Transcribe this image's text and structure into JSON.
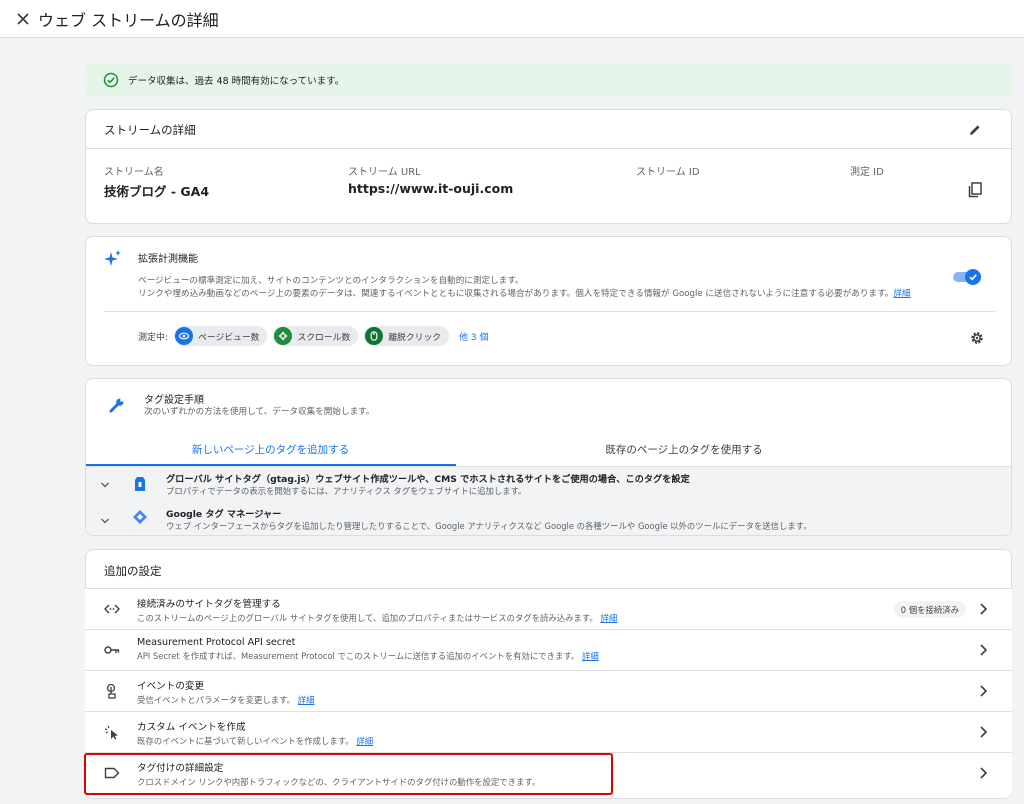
{
  "header": {
    "title": "ウェブ ストリームの詳細"
  },
  "alert": {
    "text": "データ収集は、過去 48 時間有効になっています。"
  },
  "stream_details": {
    "title": "ストリームの詳細",
    "name_label": "ストリーム名",
    "name_value": "技術ブログ - GA4",
    "url_label": "ストリーム URL",
    "url_value": "https://www.it-ouji.com",
    "id_label": "ストリーム ID",
    "measurement_id_label": "測定 ID"
  },
  "enhanced": {
    "title": "拡張計測機能",
    "desc1": "ページビューの標準測定に加え、サイトのコンテンツとのインタラクションを自動的に測定します。",
    "desc2": "リンクや埋め込み動画などのページ上の要素のデータは、関連するイベントとともに収集される場合があります。個人を特定できる情報が Google に送信されないように注意する必要があります。",
    "desc2_link": "詳細",
    "measuring_label": "測定中:",
    "chips": [
      "ページビュー数",
      "スクロール数",
      "離脱クリック"
    ],
    "more_link": "他 3 個",
    "toggle_on": true
  },
  "tagging": {
    "title": "タグ設定手順",
    "subtitle": "次のいずれかの方法を使用して、データ収集を開始します。",
    "tabs": [
      "新しいページ上のタグを追加する",
      "既存のページ上のタグを使用する"
    ],
    "options": [
      {
        "title": "グローバル サイトタグ（gtag.js）ウェブサイト作成ツールや、CMS でホストされるサイトをご使用の場合、このタグを設定",
        "desc": "プロパティでデータの表示を開始するには、アナリティクス タグをウェブサイトに追加します。"
      },
      {
        "title": "Google タグ マネージャー",
        "desc": "ウェブ インターフェースからタグを追加したり管理したりすることで、Google アナリティクスなど Google の各種ツールや Google 以外のツールにデータを送信します。"
      }
    ]
  },
  "additional": {
    "title": "追加の設定",
    "rows": [
      {
        "title": "接続済みのサイトタグを管理する",
        "desc": "このストリームのページ上のグローバル サイトタグを使用して、追加のプロパティまたはサービスのタグを読み込みます。",
        "link": "詳細",
        "badge": "0 個を接続済み"
      },
      {
        "title": "Measurement Protocol API secret",
        "desc": "API Secret を作成すれば、Measurement Protocol でこのストリームに送信する追加のイベントを有効にできます。",
        "link": "詳細"
      },
      {
        "title": "イベントの変更",
        "desc": "受信イベントとパラメータを変更します。",
        "link": "詳細"
      },
      {
        "title": "カスタム イベントを作成",
        "desc": "既存のイベントに基づいて新しいイベントを作成します。",
        "link": "詳細"
      },
      {
        "title": "タグ付けの詳細設定",
        "desc": "クロスドメイン リンクや内部トラフィックなどの、クライアントサイドのタグ付けの動作を設定できます。",
        "link": ""
      }
    ]
  },
  "colors": {
    "accent": "#1a73e8",
    "success": "#1e8e3e",
    "highlight": "#e00000"
  }
}
